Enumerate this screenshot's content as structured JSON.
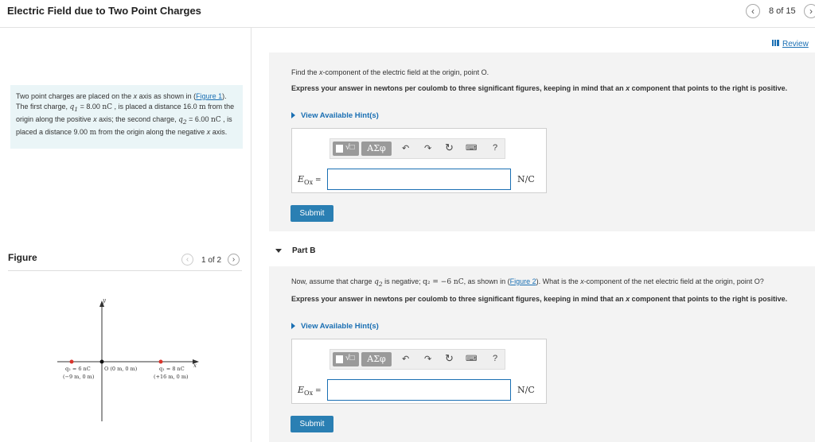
{
  "header": {
    "title": "Electric Field due to Two Point Charges",
    "pager": "8 of 15",
    "prev_icon": "chevron-left-icon",
    "next_icon": "chevron-right-icon"
  },
  "review": {
    "label": "Review"
  },
  "intro": {
    "t1": "Two point charges are placed on the ",
    "x1": "x",
    "t2": " axis as shown in (",
    "link": "Figure 1",
    "t3": "). The first charge, ",
    "q1": "q",
    "q1sub": "1",
    "t4": " = 8.00 ",
    "unit1": "nC",
    "t5": " , is placed a distance 16.0 ",
    "m1": "m",
    "t6": " from the origin along the positive ",
    "x2": "x",
    "t7": " axis; the second charge, ",
    "q2": "q",
    "q2sub": "2",
    "t8": " = 6.00 ",
    "unit2": "nC",
    "t9": " , is placed a distance 9.00 ",
    "m2": "m",
    "t10": " from the origin along the negative ",
    "x3": "x",
    "t11": " axis."
  },
  "figure": {
    "label": "Figure",
    "pager": "1 of 2",
    "y_label": "y",
    "x_label": "x",
    "q2_label": "q₂ = 6 nC",
    "q2_pos": "(−9 m, 0 m)",
    "origin_label": "O (0 m, 0 m)",
    "q1_label": "q₁ = 8 nC",
    "q1_pos": "(+16 m, 0 m)",
    "charge_color": "#d9342b"
  },
  "partA": {
    "question_pre": "Find the ",
    "question_x": "x",
    "question_post": "-component of the electric field at the origin, point O.",
    "instr_pre": "Express your answer in newtons per coulomb to three significant figures, keeping in mind that an ",
    "instr_x": "x",
    "instr_post": " component that points to the right is positive.",
    "hint": "View Available Hint(s)",
    "eq_label": "E",
    "eq_sub": "Ox",
    "eq_eq": " =",
    "unit": "N/C",
    "submit": "Submit",
    "sym_label": "ΑΣφ",
    "help": "?"
  },
  "partB": {
    "label": "Part B",
    "question_pre": "Now, assume that charge ",
    "q2": "q",
    "q2sub": "2",
    "question_mid": " is negative; ",
    "math": "q₂ = −6 nC",
    "question_mid2": ", as shown in (",
    "link": "Figure 2",
    "question_post": "). What is the ",
    "question_x": "x",
    "question_end": "-component of the net electric field at the origin, point O?",
    "instr_pre": "Express your answer in newtons per coulomb to three significant figures, keeping in mind that an ",
    "instr_x": "x",
    "instr_post": " component that points to the right is positive.",
    "hint": "View Available Hint(s)",
    "eq_label": "E",
    "eq_sub": "Ox",
    "eq_eq": " =",
    "unit": "N/C",
    "submit": "Submit",
    "sym_label": "ΑΣφ",
    "help": "?"
  }
}
